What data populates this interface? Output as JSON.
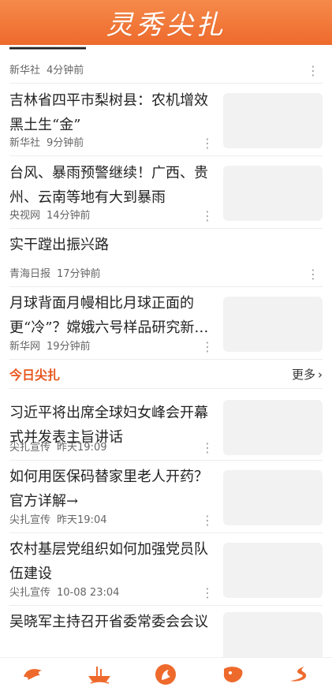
{
  "header": {
    "logo_text": "灵秀尖扎"
  },
  "top_partial": {
    "source": "新华社",
    "time": "4分钟前",
    "more_icon": "more-vertical-icon"
  },
  "news": [
    {
      "title": "吉林省四平市梨树县：农机增效黑土生“金”",
      "source": "新华社",
      "time": "9分钟前"
    },
    {
      "title": "台风、暴雨预警继续！广西、贵州、云南等地有大到暴雨",
      "source": "央视网",
      "time": "14分钟前"
    },
    {
      "title": "实干蹚出振兴路",
      "source": "青海日报",
      "time": "17分钟前"
    },
    {
      "title": "月球背面月幔相比月球正面的更“冷”？嫦娥六号样品研究新…",
      "source": "新华网",
      "time": "19分钟前"
    }
  ],
  "section": {
    "title": "今日尖扎",
    "more_label": "更多",
    "more_icon": "chevron-right-icon"
  },
  "local": [
    {
      "title": "习近平将出席全球妇女峰会开幕式并发表主旨讲话",
      "source": "尖扎宣传",
      "time": "昨天19:09"
    },
    {
      "title": "如何用医保码替家里老人开药？官方详解→",
      "source": "尖扎宣传",
      "time": "昨天19:04"
    },
    {
      "title": "农村基层党组织如何加强党员队伍建设",
      "source": "尖扎宣传",
      "time": "10-08 23:04"
    },
    {
      "title": "吴晓军主持召开省委常委会会议",
      "source": "",
      "time": ""
    }
  ],
  "tabbar": {
    "accent": "#ee6a2c",
    "icons": [
      "home-dragon-icon",
      "culture-boat-icon",
      "portrait-icon",
      "service-icon",
      "river-icon"
    ]
  }
}
